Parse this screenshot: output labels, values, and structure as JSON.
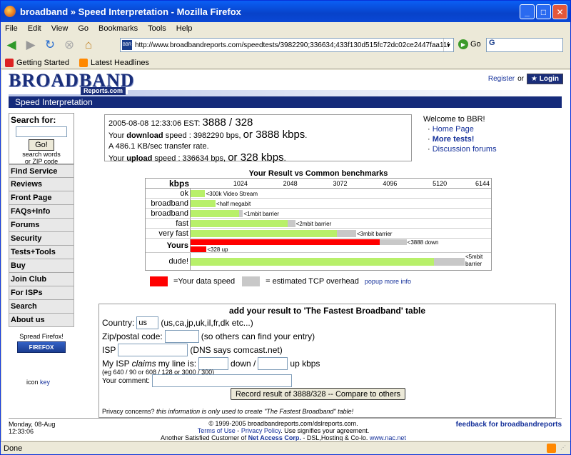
{
  "window": {
    "title": "broadband » Speed Interpretation - Mozilla Firefox"
  },
  "menu": [
    "File",
    "Edit",
    "View",
    "Go",
    "Bookmarks",
    "Tools",
    "Help"
  ],
  "nav": {
    "url": "http://www.broadbandreports.com/speedtests/3982290;336634;433f130d515fc72dc02ce2447faa1199;3.0",
    "go_label": "Go",
    "search_value": "G"
  },
  "bookmarks": [
    "Getting Started",
    "Latest Headlines"
  ],
  "status": {
    "text": "Done"
  },
  "header": {
    "logo_main": "BROADBAND",
    "logo_sub": "Reports.com",
    "register": "Register",
    "or": "or",
    "login": "Login",
    "section": "Speed Interpretation"
  },
  "sidebar": {
    "search_title": "Search for:",
    "go": "Go!",
    "search_hint1": "search words",
    "search_hint2": "or ZIP code",
    "items": [
      "Find Service",
      "Reviews",
      "Front Page",
      "FAQs+Info",
      "Forums",
      "Security",
      "Tests+Tools",
      "Buy",
      "Join Club",
      "For ISPs",
      "Search",
      "About us"
    ],
    "spread": "Spread Firefox!",
    "firefox_badge": "FIREFOX",
    "icon_text": "icon",
    "icon_key": "key"
  },
  "result": {
    "datetime": "2005-08-08 12:33:06 EST:",
    "summary": "3888 / 328",
    "line2_pre": "Your",
    "line2_bold": "download",
    "line2_mid": "speed : 3982290 bps,",
    "line2_big": "or 3888 kbps",
    "line2_end": ".",
    "line3": "A 486.1 KB/sec transfer rate.",
    "line4_pre": "Your",
    "line4_bold": "upload",
    "line4_mid": "speed : 336634 bps,",
    "line4_big": "or 328 kbps",
    "line4_end": "."
  },
  "welcome": {
    "title": "Welcome to BBR!",
    "links": [
      "Home Page",
      "More tests!",
      "Discussion forums"
    ]
  },
  "chart_data": {
    "type": "bar",
    "title": "Your Result vs Common benchmarks",
    "axis_label": "kbps",
    "xlim": [
      0,
      6144
    ],
    "ticks": [
      1024,
      2048,
      3072,
      4096,
      5120,
      6144
    ],
    "categories": [
      "ok",
      "broadband",
      "broadband",
      "fast",
      "very fast",
      "Yours",
      "Yours",
      "dude!"
    ],
    "series": [
      {
        "name": "Your data speed",
        "values": [
          300,
          512,
          1000,
          2000,
          3000,
          3888,
          328,
          5000
        ]
      },
      {
        "name": "estimated TCP overhead",
        "values": [
          0,
          0,
          76,
          150,
          400,
          550,
          0,
          630
        ]
      }
    ],
    "bar_labels": [
      "<300k Video Stream",
      "<half megabit",
      "<1mbit barrier",
      "<2mbit barrier",
      "<3mbit barrier",
      "<3888 down",
      "<328 up",
      "<5mbit barrier"
    ],
    "colors": {
      "benchmark": "#b8f06a",
      "yours": "#ff0000",
      "overhead": "#c8c8c8"
    }
  },
  "legend": {
    "data_label": "=Your data speed",
    "overhead_label": "= estimated TCP overhead",
    "popup": "popup more info"
  },
  "form": {
    "title": "add your result to 'The Fastest Broadband' table",
    "country_label": "Country:",
    "country_value": "us",
    "country_hint": "(us,ca,jp,uk,il,fr,dk etc...)",
    "zip_label": "Zip/postal code:",
    "zip_hint": "(so others can find your entry)",
    "isp_label": "ISP",
    "isp_hint": "(DNS says comcast.net)",
    "claims_pre": "My ISP",
    "claims_it": "claims",
    "claims_post": "my line is:",
    "down_label": "down /",
    "up_label": "up kbps",
    "eg": "(eg 640 / 90 or 608 / 128 or 3000 / 300)",
    "comment_label": "Your comment:",
    "submit": "Record result of 3888/328 -- Compare to others",
    "privacy_pre": "Privacy concerns?",
    "privacy_it": "this information is only used to create \"The Fastest Broadband\" table!"
  },
  "footer": {
    "date1": "Monday, 08-Aug",
    "date2": "12:33:06",
    "copyright": "© 1999-2005 broadbandreports.com/dslreports.com.",
    "terms": "Terms of Use",
    "dash": "-",
    "privacy": "Privacy Policy",
    "terms_tail": ". Use signifies your agreement.",
    "another": "Another Satisfied Customer of",
    "nac": "Net Access Corp.",
    "dsl": "- DSL,Hosting & Co-lo.",
    "nacurl": "www.nac.net",
    "feedback": "feedback for broadbandreports"
  }
}
